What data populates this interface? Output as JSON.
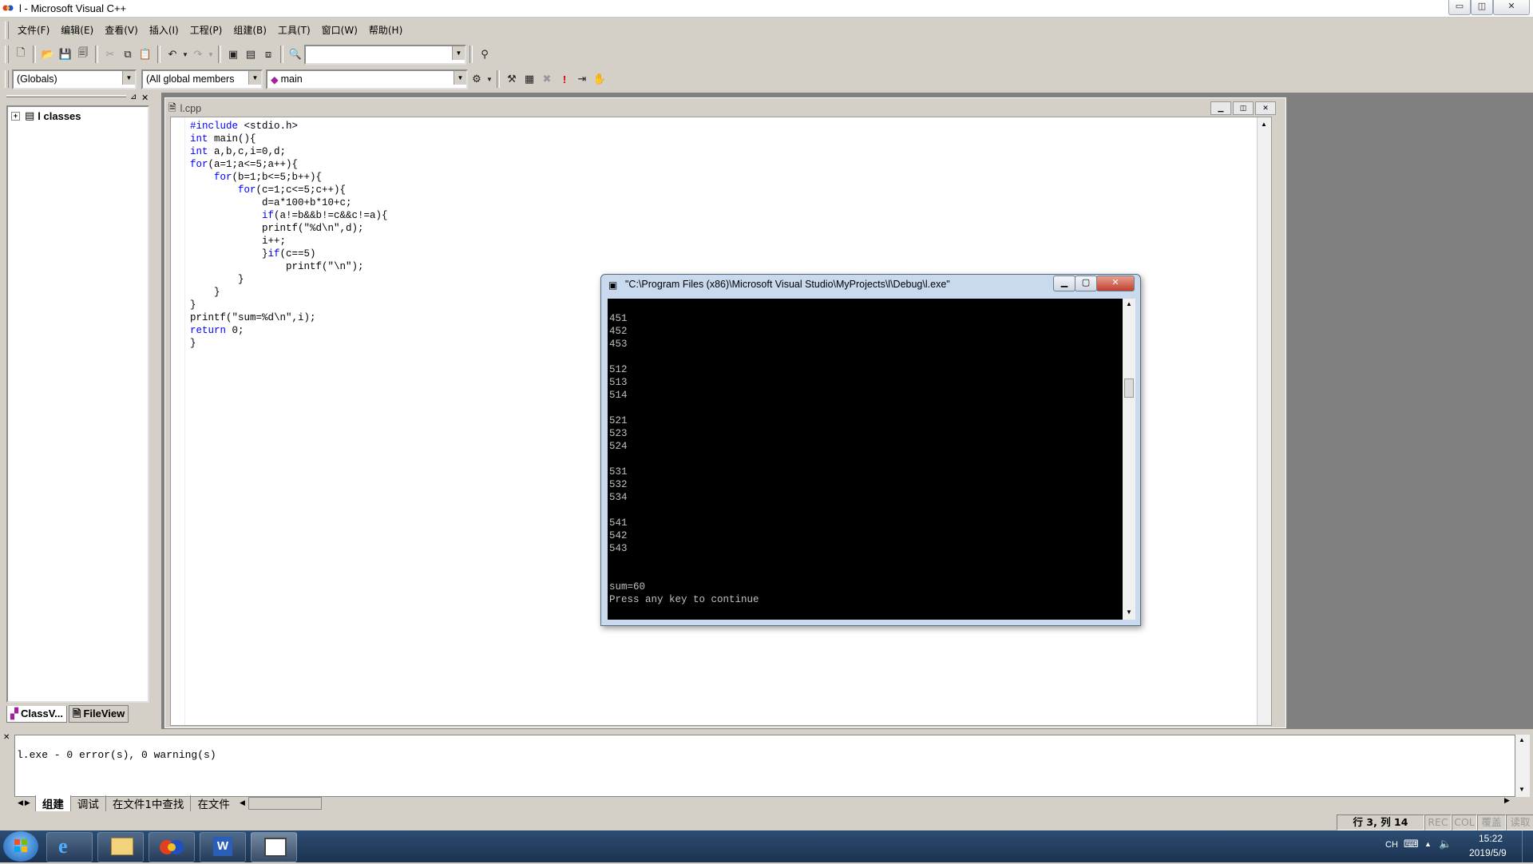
{
  "window": {
    "title": "l - Microsoft Visual C++",
    "min": "▭",
    "max": "◫",
    "close": "✕"
  },
  "menu": [
    "文件(F)",
    "编辑(E)",
    "查看(V)",
    "插入(I)",
    "工程(P)",
    "组建(B)",
    "工具(T)",
    "窗口(W)",
    "帮助(H)"
  ],
  "toolbar2": {
    "scope": "(Globals)",
    "members": "(All global members",
    "function": "main"
  },
  "workspace": {
    "tree_root": "l classes",
    "tab_class": "ClassV...",
    "tab_file": "FileView"
  },
  "editor": {
    "title": "l.cpp",
    "code": [
      "#include <stdio.h>",
      "int main(){",
      "int a,b,c,i=0,d;",
      "for(a=1;a<=5;a++){",
      "    for(b=1;b<=5;b++){",
      "        for(c=1;c<=5;c++){",
      "            d=a*100+b*10+c;",
      "            if(a!=b&&b!=c&&c!=a){",
      "            printf(\"%d\\n\",d);",
      "            i++;",
      "            }if(c==5)",
      "                printf(\"\\n\");",
      "        }",
      "    }",
      "}",
      "printf(\"sum=%d\\n\",i);",
      "return 0;",
      "}"
    ]
  },
  "console": {
    "title": "\"C:\\Program Files (x86)\\Microsoft Visual Studio\\MyProjects\\l\\Debug\\l.exe\"",
    "lines": [
      "451",
      "452",
      "453",
      "",
      "512",
      "513",
      "514",
      "",
      "521",
      "523",
      "524",
      "",
      "531",
      "532",
      "534",
      "",
      "541",
      "542",
      "543",
      "",
      "",
      "sum=60",
      "Press any key to continue"
    ]
  },
  "output": {
    "text": "l.exe - 0 error(s), 0 warning(s)",
    "tabs": [
      "组建",
      "调试",
      "在文件1中查找",
      "在文件"
    ]
  },
  "status": {
    "position": "行 3, 列 14",
    "rec": "REC",
    "col": "COL",
    "ovr": "覆盖",
    "read": "读取"
  },
  "taskbar": {
    "lang": "CH",
    "time": "15:22",
    "date": "2019/5/9"
  }
}
